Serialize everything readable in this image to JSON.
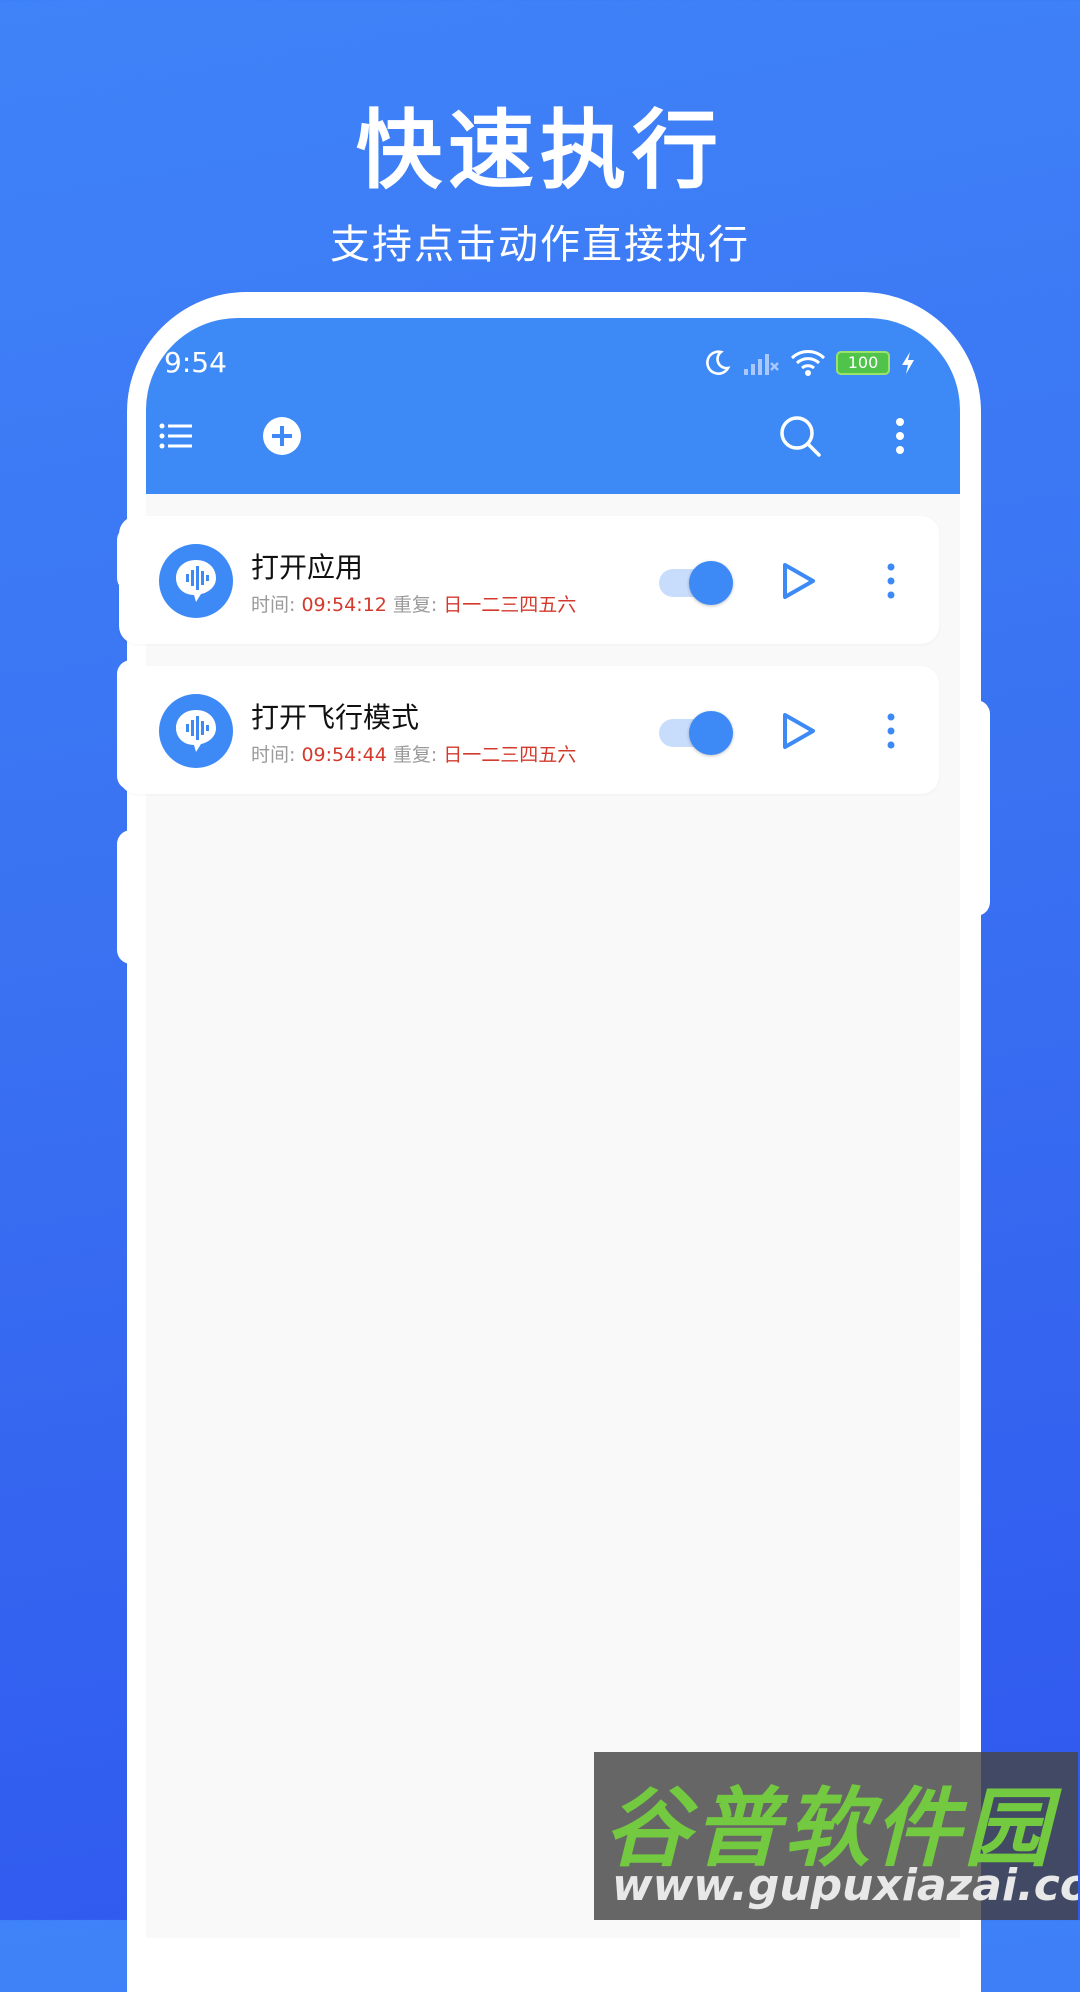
{
  "promo": {
    "title": "快速执行",
    "subtitle": "支持点击动作直接执行"
  },
  "status_bar": {
    "time": "9:54",
    "battery": "100"
  },
  "toolbar": {
    "icons": [
      "list-icon",
      "add-circle-icon",
      "search-icon",
      "more-vert-icon"
    ]
  },
  "tasks": [
    {
      "title": "打开应用",
      "time_label": "时间:",
      "time_value": "09:54:12",
      "repeat_label": "重复:",
      "repeat_value": "日一二三四五六",
      "enabled": true
    },
    {
      "title": "打开飞行模式",
      "time_label": "时间:",
      "time_value": "09:54:44",
      "repeat_label": "重复:",
      "repeat_value": "日一二三四五六",
      "enabled": true
    }
  ],
  "watermark": {
    "brand": "谷普软件园",
    "url": "www.gupuxiazai.com"
  },
  "colors": {
    "accent": "#3d8af7",
    "highlight_text": "#d33a2c",
    "background_top": "#3f83f8",
    "background_bottom": "#2f57ee"
  }
}
